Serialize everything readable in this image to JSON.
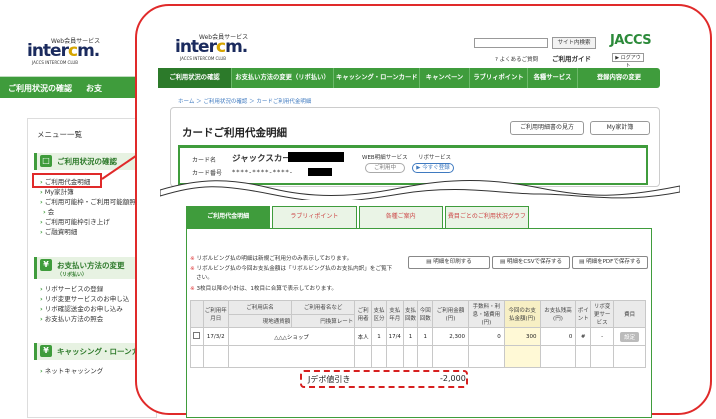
{
  "bg_page": {
    "logo_top": "Web会員サービス",
    "logo_main_a": "inter",
    "logo_main_b": "c",
    "logo_main_c": "m.",
    "logo_sub": "JACCS INTERCOM CLUB",
    "nav_items": [
      "ご利用状況の確認",
      "お支"
    ],
    "menu_title": "メニュー一覧",
    "sections": [
      {
        "title": "ご利用状況の確認",
        "small": "",
        "icon": "□",
        "items": [
          "ご利用代金明細",
          "My家計簿",
          "ご利用可能枠・ご利用可能額照",
          "会",
          "ご利用可能枠引き上げ",
          "ご融資明細"
        ]
      },
      {
        "title": "お支払い方法の変更",
        "small": "（リボ払い）",
        "icon": "¥",
        "items": [
          "リボサービスの登録",
          "リボ変更サービスのお申し込",
          "リボ確認送金のお申し込み",
          "お支払い方法の照会"
        ]
      },
      {
        "title": "キャッシング・ローンカード",
        "small": "",
        "icon": "¥",
        "items": [
          "ネットキャッシング"
        ]
      }
    ]
  },
  "header": {
    "logo_top": "Web会員サービス",
    "logo_main_a": "inter",
    "logo_main_b": "c",
    "logo_main_c": "m.",
    "logo_sub": "JACCS INTERCOM CLUB",
    "search_btn": "サイト内検索",
    "brand": "JACCS",
    "faq": "? よくあるご質問",
    "guide": "ご利用ガイド",
    "logout": "▶ ログアウト"
  },
  "nav": [
    "ご利用状況の確認",
    "お支払い方法の変更（リボ払い）",
    "キャッシング・ローンカード",
    "キャンペーン",
    "ラブリィポイント",
    "各種サービス",
    "登録内容の変更"
  ],
  "breadcrumb": "ホーム ＞ ご利用状況の確認 ＞ カードご利用代金明細",
  "page": {
    "title": "カードご利用代金明細",
    "btn_view": "ご利用明細書の見方",
    "btn_budget": "My家計簿"
  },
  "card": {
    "name_label": "カード名",
    "name_value": "ジャックスカード",
    "number_label": "カード番号",
    "number_value": "****-****-****-",
    "web_label": "WEB明細サービス",
    "web_btn": "ご利用中",
    "ribo_label": "リボサービス",
    "ribo_btn": "▶ 今すぐ登録"
  },
  "tabs": [
    "ご利用代金明細",
    "ラブリィポイント",
    "各種ご案内",
    "費目ごとのご利用状況グラフ"
  ],
  "notes": [
    "リボルビング払の明細は新規ご利用分のみ表示しております。",
    "リボルビング払の今回お支払金額は「リボルビング払のお支払内訳」をご覧下",
    "さい。",
    "3枚目以降の小計は、1枚目に合算で表示しております。"
  ],
  "actions": [
    "明細を印刷する",
    "明細をCSVで保存する",
    "明細をPDFで保存する"
  ],
  "table": {
    "headers1": [
      "",
      "ご利用年月日",
      "ご利用店名",
      "ご利用者名など",
      "ご利用者",
      "支払区分",
      "支払年月",
      "支払回数",
      "今回回数",
      "ご利用金額(円)",
      "手数料・利息・諸費用(円)",
      "今回のお支払金額(円)",
      "お支払残高(円)",
      "ポイント",
      "リボ変更サービス",
      "費目"
    ],
    "sub_left": "現地通貨額",
    "sub_right": "円換算レート",
    "row": {
      "date": "17/3/2",
      "shop": "△△△ショップ",
      "user": "本人",
      "method": "1",
      "month": "17/4",
      "times": "1",
      "count": "1",
      "amount": "2,300",
      "fee": "0",
      "pay": "300",
      "balance": "0",
      "point": "#",
      "ribo": "-",
      "cat_btn": "設定"
    },
    "discount_label": "Jデポ値引き",
    "discount_value": "-2,000"
  }
}
